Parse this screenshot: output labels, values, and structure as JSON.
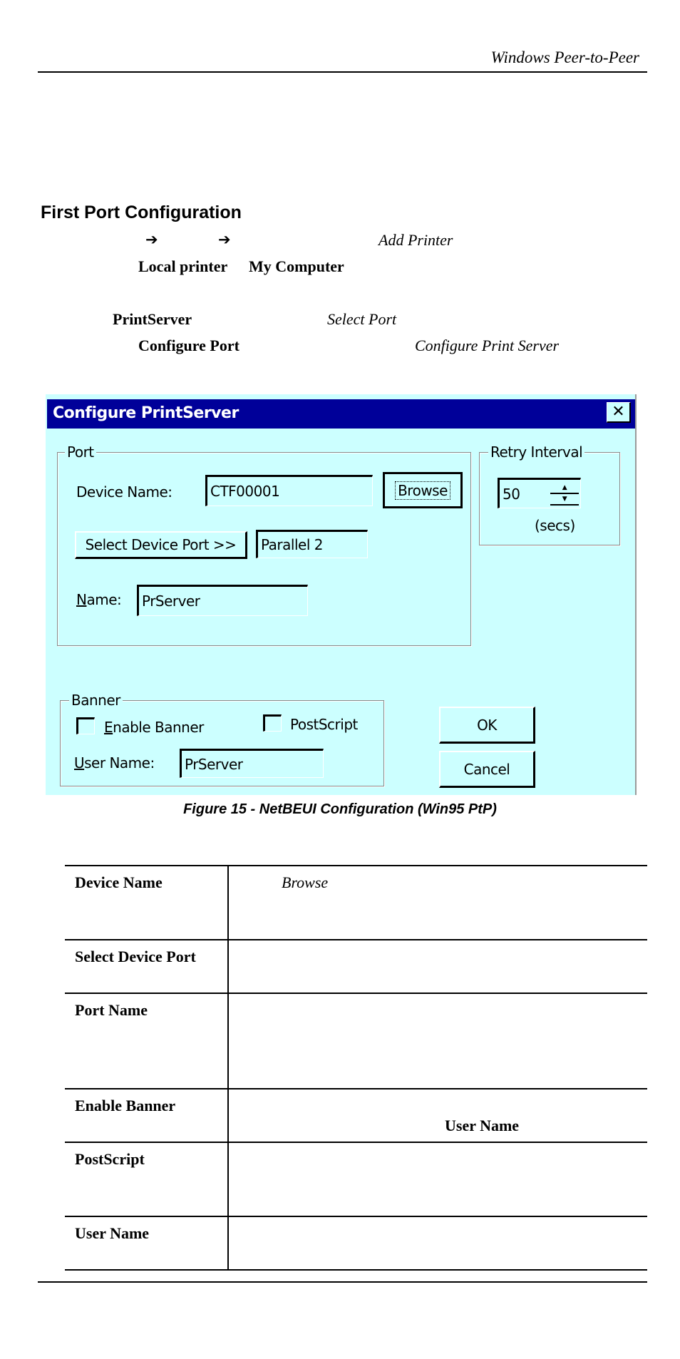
{
  "page_header": {
    "title": "Windows Peer-to-Peer"
  },
  "section": {
    "heading": "First Port Configuration",
    "step1": {
      "arrow1": "➔",
      "arrow2": "➔",
      "italic": "Add Printer"
    },
    "step2": {
      "bold1": "Local printer",
      "bold2": "My Computer"
    },
    "step3": {
      "bold": "PrintServer",
      "italic": "Select Port"
    },
    "step4": {
      "bold": "Configure Port",
      "italic": "Configure Print Server"
    }
  },
  "dialog": {
    "title": "Configure PrintServer",
    "close_icon": "close-x-icon",
    "port_group": {
      "legend": "Port",
      "device_name_label": "Device Name:",
      "device_name_value": "CTF00001",
      "browse_label": "Browse",
      "select_device_port_label": "Select Device Port >>",
      "device_port_value": "Parallel 2",
      "name_label_accel": "N",
      "name_label_rest": "ame:",
      "name_value": "PrServer"
    },
    "retry_group": {
      "legend": "Retry Interval",
      "value": "50",
      "units": "(secs)"
    },
    "banner_group": {
      "legend": "Banner",
      "enable_banner_accel": "E",
      "enable_banner_rest": "nable Banner",
      "enable_banner_checked": false,
      "postscript_label": "PostScript",
      "postscript_checked": false,
      "user_name_accel": "U",
      "user_name_rest": "ser Name:",
      "user_name_value": "PrServer"
    },
    "ok_label": "OK",
    "cancel_label": "Cancel"
  },
  "figure_caption": "Figure 15 - NetBEUI Configuration (Win95 PtP)",
  "table": {
    "rows": [
      {
        "key": "Device Name",
        "value_italic": "Browse",
        "value_bold": ""
      },
      {
        "key": "Select Device Port",
        "value_italic": "",
        "value_bold": ""
      },
      {
        "key": "Port Name",
        "value_italic": "",
        "value_bold": ""
      },
      {
        "key": "Enable Banner",
        "value_italic": "",
        "value_bold": "User Name"
      },
      {
        "key": "PostScript",
        "value_italic": "",
        "value_bold": ""
      },
      {
        "key": "User Name",
        "value_italic": "",
        "value_bold": ""
      }
    ]
  }
}
